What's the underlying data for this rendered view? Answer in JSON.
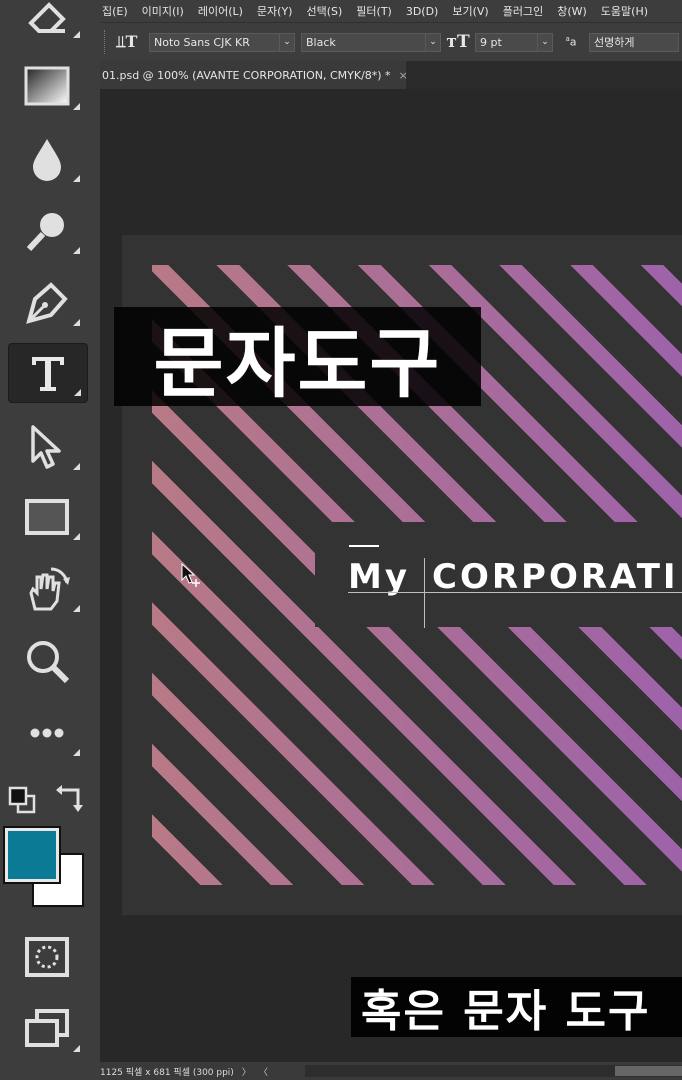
{
  "menu": [
    "집(E)",
    "이미지(I)",
    "레이어(L)",
    "문자(Y)",
    "선택(S)",
    "필터(T)",
    "3D(D)",
    "보기(V)",
    "플러그인",
    "창(W)",
    "도움말(H)"
  ],
  "options": {
    "font_family": "Noto Sans CJK KR",
    "font_style": "Black",
    "font_size": "9 pt",
    "aa_label": "a",
    "antialias": "선명하게"
  },
  "tab": {
    "title": "01.psd @ 100% (AVANTE CORPORATION, CMYK/8*) *",
    "close": "×"
  },
  "canvas": {
    "title_caption": "문자도구",
    "my_text": "My",
    "corp_text": "CORPORATI",
    "sub_caption": "혹은 문자 도구"
  },
  "status": {
    "doc_info": "1125 픽셀 x 681 픽셀 (300 ppi)",
    "nav_right": "〉",
    "nav_left": "〈"
  },
  "colors": {
    "foreground": "#0b7a94",
    "background": "#ffffff",
    "stripe_start": "#b87a86",
    "stripe_end": "#9a5fae"
  },
  "tools": [
    "eraser-icon",
    "gradient-icon",
    "blur-icon",
    "dodge-icon",
    "pen-icon",
    "type-icon",
    "path-select-icon",
    "rectangle-icon",
    "hand-rotate-icon",
    "zoom-icon",
    "more-tools-icon",
    "default-colors-icon",
    "swap-colors-icon",
    "quick-mask-icon",
    "screen-mode-icon"
  ]
}
